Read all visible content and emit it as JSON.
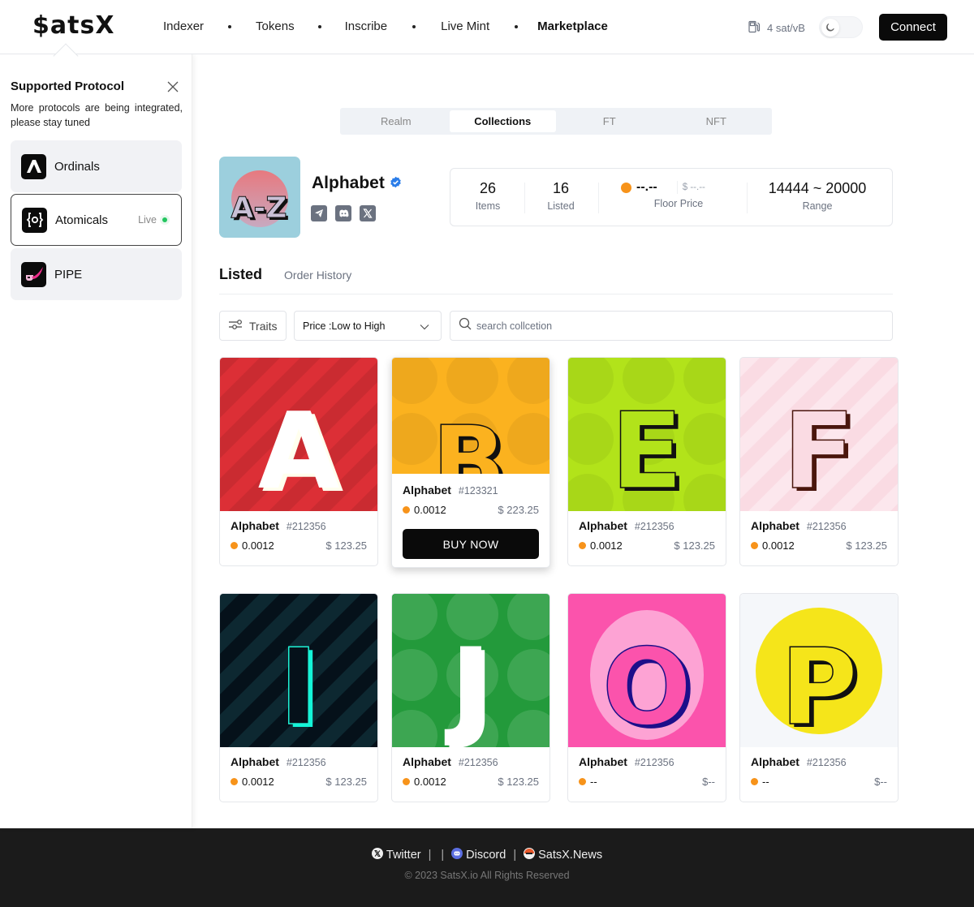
{
  "header": {
    "logo": "$atsX",
    "nav": [
      {
        "label": "Indexer",
        "active": false
      },
      {
        "label": "Tokens",
        "active": false
      },
      {
        "label": "Inscribe",
        "active": false
      },
      {
        "label": "Live Mint",
        "active": false
      },
      {
        "label": "Marketplace",
        "active": true
      }
    ],
    "gas": "4 sat/vB",
    "theme_icon": "moon-icon",
    "connect_label": "Connect"
  },
  "sidebar": {
    "title": "Supported Protocol",
    "description": "More protocols are being integrated, please stay tuned",
    "protocols": [
      {
        "label": "Ordinals",
        "icon": "ordinals-logo-icon",
        "active": false,
        "status": ""
      },
      {
        "label": "Atomicals",
        "icon": "atomicals-logo-icon",
        "active": true,
        "status": "Live"
      },
      {
        "label": "PIPE",
        "icon": "pipe-logo-icon",
        "active": false,
        "status": ""
      }
    ]
  },
  "tabs": [
    {
      "label": "Realm",
      "active": false
    },
    {
      "label": "Collections",
      "active": true
    },
    {
      "label": "FT",
      "active": false
    },
    {
      "label": "NFT",
      "active": false
    }
  ],
  "collection": {
    "name": "Alphabet",
    "avatar_text": "A-Z",
    "verified": true,
    "socials": [
      "telegram-icon",
      "discord-icon",
      "x-icon"
    ],
    "stats": {
      "items": {
        "value": "26",
        "label": "Items"
      },
      "listed": {
        "value": "16",
        "label": "Listed"
      },
      "floor": {
        "btc": "--.--",
        "usd": "$ --.--",
        "label": "Floor Price"
      },
      "range": {
        "value": "14444 ~ 20000",
        "label": "Range"
      }
    }
  },
  "listing": {
    "tabs": [
      {
        "label": "Listed",
        "active": true
      },
      {
        "label": "Order History",
        "active": false
      }
    ],
    "traits_label": "Traits",
    "sort_label": "Price :Low to High",
    "search_placeholder": "search collcetion",
    "buy_label": "BUY NOW"
  },
  "items": [
    {
      "letter": "A",
      "name": "Alphabet",
      "id": "#212356",
      "btc": "0.0012",
      "usd": "$ 123.25",
      "bg": "#dc2f36"
    },
    {
      "letter": "B",
      "name": "Alphabet",
      "id": "#123321",
      "btc": "0.0012",
      "usd": "$ 223.25",
      "bg": "#fbb21f",
      "hovered": true
    },
    {
      "letter": "E",
      "name": "Alphabet",
      "id": "#212356",
      "btc": "0.0012",
      "usd": "$ 123.25",
      "bg": "#b2e31a"
    },
    {
      "letter": "F",
      "name": "Alphabet",
      "id": "#212356",
      "btc": "0.0012",
      "usd": "$ 123.25",
      "bg": "#fadbe3"
    },
    {
      "letter": "I",
      "name": "Alphabet",
      "id": "#212356",
      "btc": "0.0012",
      "usd": "$ 123.25",
      "bg": "#05111a"
    },
    {
      "letter": "J",
      "name": "Alphabet",
      "id": "#212356",
      "btc": "0.0012",
      "usd": "$ 123.25",
      "bg": "#239a3b"
    },
    {
      "letter": "O",
      "name": "Alphabet",
      "id": "#212356",
      "btc": "--",
      "usd": "$--",
      "bg": "#fb53ac"
    },
    {
      "letter": "P",
      "name": "Alphabet",
      "id": "#212356",
      "btc": "--",
      "usd": "$--",
      "bg": "#f5f7fa"
    }
  ],
  "footer": {
    "links": [
      {
        "label": "Twitter",
        "icon": "x-icon"
      },
      {
        "label": "Discord",
        "icon": "discord-icon"
      },
      {
        "label": "SatsX.News",
        "icon": "news-icon"
      }
    ],
    "copyright": "© 2023 SatsX.io All Rights Reserved"
  }
}
